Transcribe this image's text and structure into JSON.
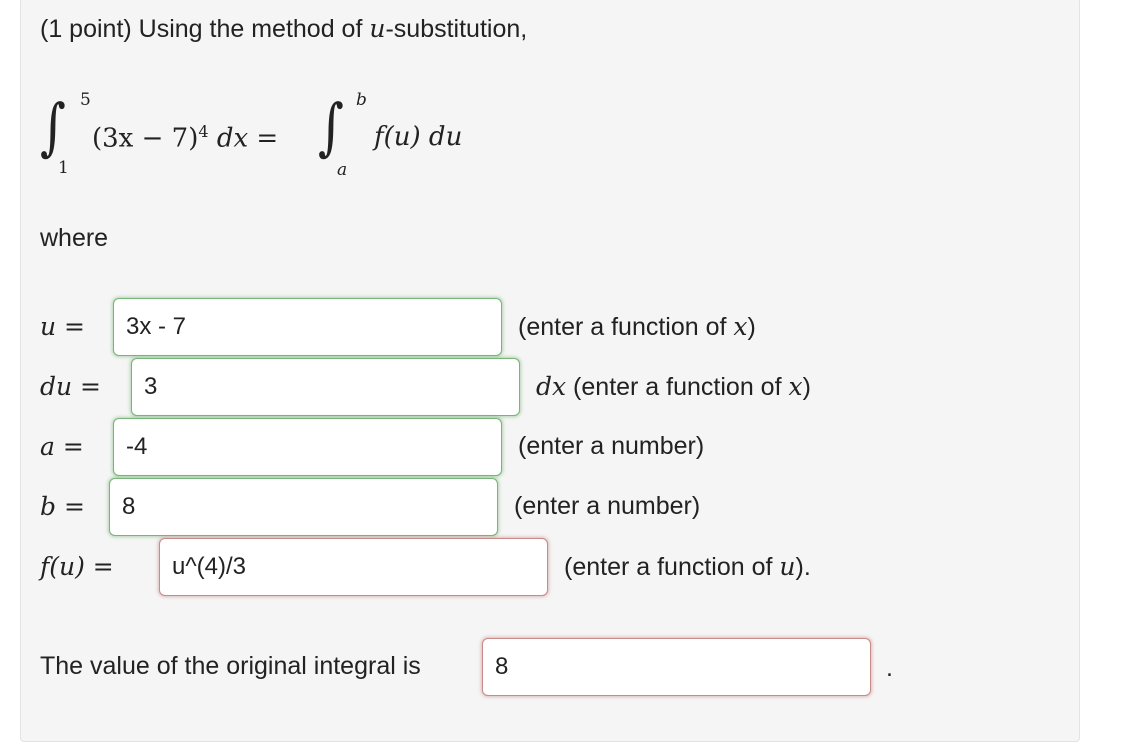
{
  "intro": {
    "prefix": "(1 point) Using the method of ",
    "var": "u",
    "suffix": "-substitution,"
  },
  "equation": {
    "lower_left": "1",
    "upper_left": "5",
    "integrand_left": "(3x − 7)",
    "power": "4",
    "dx": "dx",
    "equals": "=",
    "lower_right": "a",
    "upper_right": "b",
    "integrand_right": "f(u) du"
  },
  "where_label": "where",
  "rows": {
    "u": {
      "label": "u =",
      "value": "3x - 7",
      "hint_prefix": "(enter a function of ",
      "hint_var": "x",
      "hint_suffix": ")"
    },
    "du": {
      "label": "du =",
      "value": "3",
      "dx": "dx",
      "hint_prefix": " (enter a function of ",
      "hint_var": "x",
      "hint_suffix": ")"
    },
    "a": {
      "label": "a =",
      "value": "-4",
      "hint": "(enter a number)"
    },
    "b": {
      "label": "b =",
      "value": "8",
      "hint": "(enter a number)"
    },
    "fu": {
      "label": "f(u) =",
      "value": "u^(4)/3",
      "hint_prefix": "(enter a function of ",
      "hint_var": "u",
      "hint_suffix": ")."
    }
  },
  "final": {
    "label": "The value of the original integral is",
    "value": "8",
    "period": "."
  },
  "colors": {
    "correct": "#78b578",
    "incorrect": "#c98a8a"
  }
}
